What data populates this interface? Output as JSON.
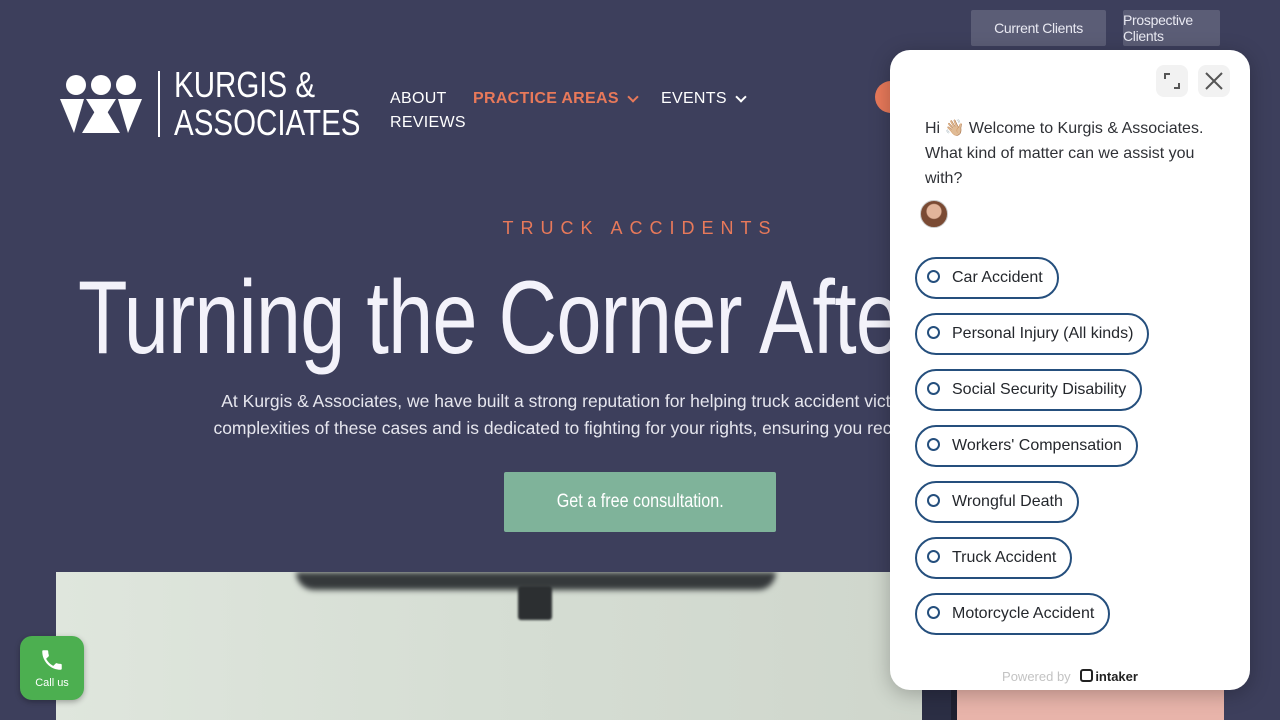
{
  "top_buttons": {
    "current_clients": "Current Clients",
    "prospective_clients": "Prospective Clients"
  },
  "logo": {
    "line1": "KURGIS &",
    "line2": "ASSOCIATES"
  },
  "nav": {
    "items": [
      {
        "label": "ABOUT",
        "has_dropdown": false,
        "active": false
      },
      {
        "label": "PRACTICE AREAS",
        "has_dropdown": true,
        "active": true
      },
      {
        "label": "EVENTS",
        "has_dropdown": true,
        "active": false
      },
      {
        "label": "REVIEWS",
        "has_dropdown": false,
        "active": false
      }
    ]
  },
  "hero": {
    "eyebrow": "TRUCK ACCIDENTS",
    "headline": "Turning the Corner After",
    "intro_line1": "At Kurgis & Associates, we have built a strong reputation for helping truck accident victims in Columbus. Our",
    "intro_line2": "complexities of these cases and is dedicated to fighting for your rights, ensuring you receive the compensation",
    "cta": "Get a free consultation."
  },
  "call_button": {
    "label": "Call us"
  },
  "chat": {
    "greeting": "Hi 👋🏼 Welcome to Kurgis & Associates. What kind of matter can we assist you with?",
    "options": [
      "Car Accident",
      "Personal Injury (All kinds)",
      "Social Security Disability",
      "Workers' Compensation",
      "Wrongful Death",
      "Truck Accident",
      "Motorcycle Accident"
    ],
    "powered_by": "Powered by",
    "brand": "intaker"
  },
  "colors": {
    "background": "#3d3f5c",
    "accent": "#e8795a",
    "cta": "#7fb39a",
    "option_border": "#254f7d",
    "call_green": "#4caf50"
  }
}
